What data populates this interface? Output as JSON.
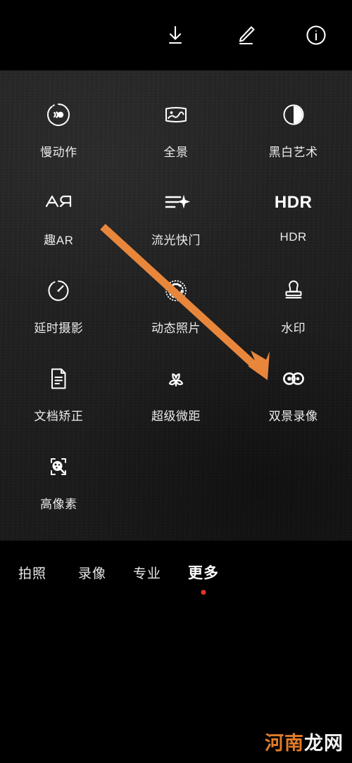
{
  "topbar": {
    "icons": [
      {
        "name": "download-icon",
        "label": "下载"
      },
      {
        "name": "edit-icon",
        "label": "编辑"
      },
      {
        "name": "info-icon",
        "label": "信息"
      }
    ]
  },
  "panel": {
    "modes": [
      {
        "label": "慢动作",
        "icon": "slow-motion-icon"
      },
      {
        "label": "全景",
        "icon": "panorama-icon"
      },
      {
        "label": "黑白艺术",
        "icon": "monochrome-icon"
      },
      {
        "label": "趣AR",
        "icon": "ar-lens-icon"
      },
      {
        "label": "流光快门",
        "icon": "light-painting-icon"
      },
      {
        "label": "HDR",
        "icon": "hdr-icon",
        "glyph": "HDR"
      },
      {
        "label": "延时摄影",
        "icon": "time-lapse-icon"
      },
      {
        "label": "动态照片",
        "icon": "live-photo-icon"
      },
      {
        "label": "水印",
        "icon": "watermark-stamp-icon"
      },
      {
        "label": "文档矫正",
        "icon": "document-correction-icon"
      },
      {
        "label": "超级微距",
        "icon": "super-macro-icon"
      },
      {
        "label": "双景录像",
        "icon": "dual-view-video-icon"
      },
      {
        "label": "高像素",
        "icon": "high-resolution-icon"
      }
    ]
  },
  "annotation": {
    "arrow_color": "#e8873c",
    "points_to": "双景录像"
  },
  "modebar": {
    "tabs": [
      {
        "label": "拍照",
        "active": false
      },
      {
        "label": "录像",
        "active": false
      },
      {
        "label": "专业",
        "active": false
      },
      {
        "label": "更多",
        "active": true
      }
    ],
    "indicator_color": "#e5342a"
  },
  "watermark": {
    "part_one": "河南",
    "part_two": "龙网",
    "color_one": "#e07b2a",
    "color_two": "#f2f2f2"
  }
}
